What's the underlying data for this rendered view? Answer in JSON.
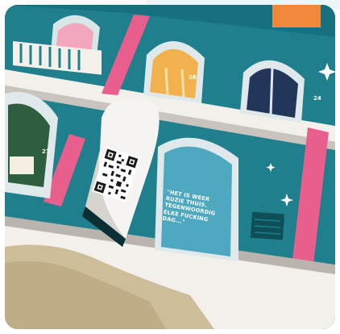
{
  "scene": {
    "quote_lines": [
      "\"HET IS WEER",
      "RUZIE THUIS.",
      "TEGENWOORDIG",
      "ELKE FUCKING",
      "DAG...\""
    ],
    "door_numbers": [
      "27",
      "28",
      "24"
    ]
  },
  "colors": {
    "facade_teal": "#1f7f8c",
    "facade_dark": "#0f4f58",
    "pink_pillar": "#e85f8e",
    "window_light": "#f1b24e",
    "door_panel": "#4ea8c0",
    "card_white": "#f5f4f2",
    "wool": "#cdbd98"
  }
}
